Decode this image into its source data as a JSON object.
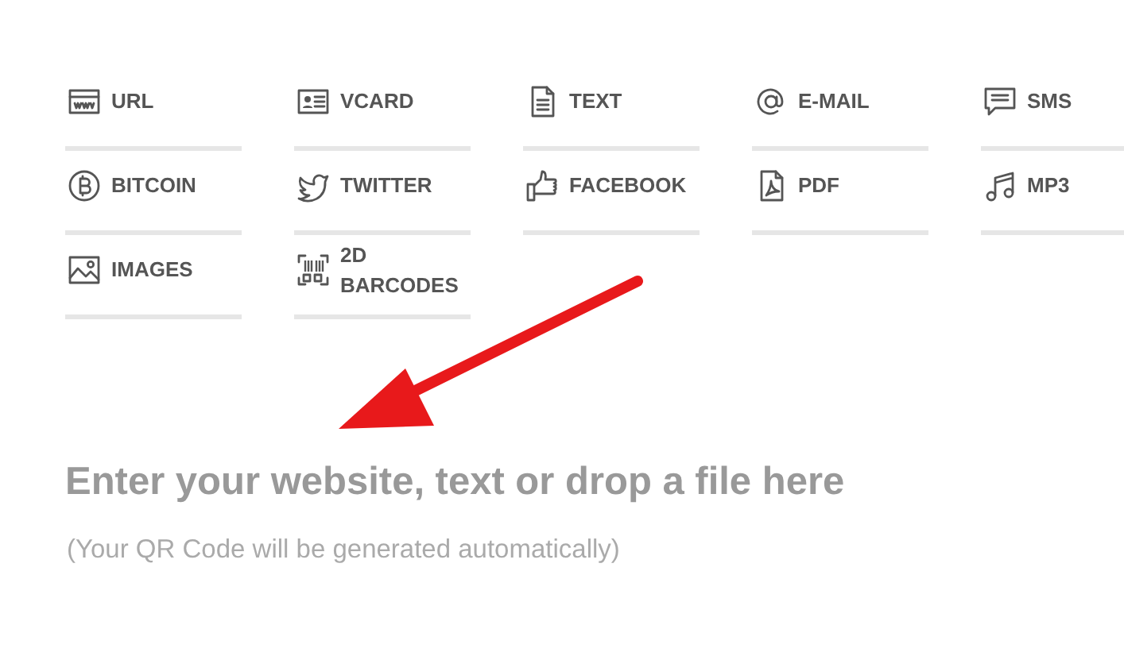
{
  "types": [
    {
      "kind": "url",
      "label": "URL"
    },
    {
      "kind": "vcard",
      "label": "VCARD"
    },
    {
      "kind": "text",
      "label": "TEXT"
    },
    {
      "kind": "email",
      "label": "E-MAIL"
    },
    {
      "kind": "sms",
      "label": "SMS"
    },
    {
      "kind": "bitcoin",
      "label": "BITCOIN"
    },
    {
      "kind": "twitter",
      "label": "TWITTER"
    },
    {
      "kind": "facebook",
      "label": "FACEBOOK"
    },
    {
      "kind": "pdf",
      "label": "PDF"
    },
    {
      "kind": "mp3",
      "label": "MP3"
    },
    {
      "kind": "images",
      "label": "IMAGES"
    },
    {
      "kind": "barcodes",
      "label": "2D BARCODES"
    }
  ],
  "input": {
    "placeholder": "Enter your website, text or drop a file here"
  },
  "hint": "(Your QR Code will be generated automatically)"
}
